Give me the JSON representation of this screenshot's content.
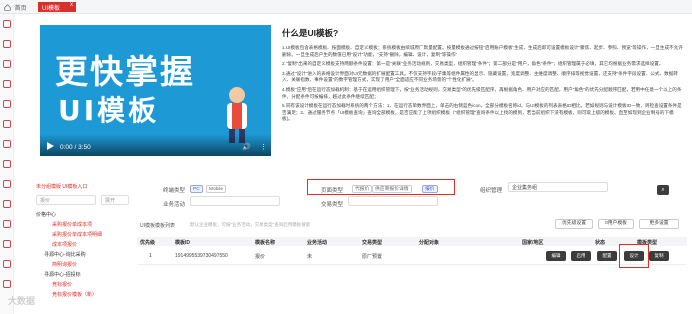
{
  "topbar": {
    "home_label": "首页",
    "active_tab": "UI模板",
    "close": "x"
  },
  "video": {
    "line1": "更快掌握",
    "line2": "UI模板",
    "time": "0:00 / 3:50",
    "volume_icon": "volume-icon",
    "more_icon": "more-icon"
  },
  "description": {
    "title": "什么是UI模板?",
    "paragraphs": [
      "1.UI模板包含表格模板、按面模板、自定义模板；系统模板由缤城原厂默量配置。按量模板通过按钮\"启用账户模板\"生成，生成后即可设置模板设计\"聚焦、起步、参照、预览\"等操作，一旦生成不允许删除。一旦生成后户生的数值已用\"设计\"功能，\"支持\"删除，编辑、设计，复制\"等操作\"",
      "2.\"复制\"出来的自定义模板支持两额条件设置：第一是\"关联\"业务活动规则，交易类型，组织管理\"条件\"；第二部分是\"用户，角色\"条件\"；组织管理属于必填，其它均根据业务需求选择设置。",
      "3.通过\"设计\"进入的表格设计界面对UI元数据的扩展配置工具。不仅支持字段/子集等组件属性的显示、隐藏设置，宽度调整、主维度调整、顺序排等视觉设置，还支持\"条件字段设置、公式、数据转入、关联指数、事件设置\"的数字管理方式，实现了用户\"全面适应不同业务场景的\"个性化扩展\"。",
      "4.模板\"应用\"后在运行态加载机制：基于在运用组织管理下，按\"业务活动规则，交易类型\"的优先级匹配序，再根据角色、用户对应的匹配，用户\"角色\"的优先分配顺序匹配，若用中任意一个以上的条件，分配条件可按编排，越过此条件继续匹配；",
      "5.同有该设计模板在运行态加载时系统的两个方法：1、在运行态单数界面上，单击的右侧蓝色icon，全部分模板名称id，与UI模板的列表表格ID相比，若如规则与设计模板ID一致，则检查设置条件是否满足；2、通过服务节点「UI模板查询」查询全部模板，是否应能了上项组织模板（\"组织管理\"查询条件以上找的模到，若当前组织下没有模板，则可取上级的模板。直至如现到企业制号的下模板)。"
    ]
  },
  "filters": {
    "left_title": "未分组模版",
    "left_title2": "UI模板入口",
    "template_type_label": "终端类型",
    "pc_label": "PC",
    "mobile_label": "Mobile",
    "page_type_label": "页面类型",
    "page_types": [
      "代报价",
      "供应商报价详情",
      "报价"
    ],
    "org_label": "组织管理",
    "org_value": "企业集务组",
    "biz_label": "业务活动",
    "tx_label": "交易类型",
    "search_placeholder": "报价",
    "sort_label": "展开"
  },
  "tree": [
    {
      "label": "价格中心",
      "indent": 0,
      "highlight": false
    },
    {
      "label": "采购报价单成本项",
      "indent": 2,
      "highlight": true
    },
    {
      "label": "采购报价单成本项明细",
      "indent": 2,
      "highlight": true
    },
    {
      "label": "成本项报价",
      "indent": 2,
      "highlight": true
    },
    {
      "label": "寻源中心-询比采购",
      "indent": 1,
      "highlight": false
    },
    {
      "label": "简明询报价",
      "indent": 2,
      "highlight": true
    },
    {
      "label": "寻源中心-招投标",
      "indent": 1,
      "highlight": false
    },
    {
      "label": "竞标报价",
      "indent": 2,
      "highlight": true
    },
    {
      "label": "竞标报价模板（新）",
      "indent": 2,
      "highlight": true
    }
  ],
  "toolbar": {
    "title": "UI模板模板列表",
    "note": "默认企业模板，可按\"业务活动，交易类型\"查询启用模板搜索",
    "btn_priority": "优先级设置",
    "btn_user": "0用户模板",
    "btn_more": "更多设置"
  },
  "table": {
    "headers": [
      "优先级",
      "模板ID",
      "模板名称",
      "业务活动",
      "交易类型",
      "分配对象",
      "国家/地区",
      "状态",
      "模板类型"
    ],
    "rows": [
      [
        "1",
        "1914995539730497550",
        "报价",
        "未",
        "原厂预置",
        "",
        "",
        "",
        ""
      ]
    ],
    "actions": [
      "编辑",
      "启用",
      "配置",
      "设计",
      "复制"
    ]
  },
  "watermark": "大数据"
}
